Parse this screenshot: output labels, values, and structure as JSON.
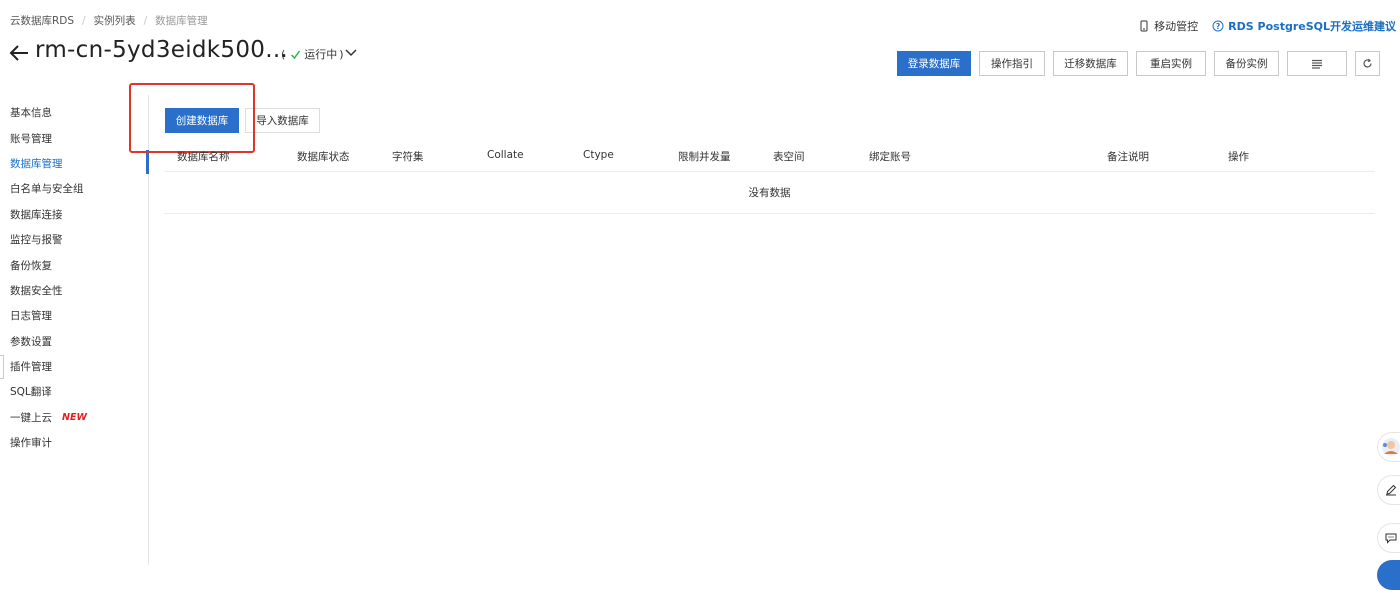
{
  "breadcrumb": {
    "items": [
      "云数据库RDS",
      "实例列表",
      "数据库管理"
    ]
  },
  "top_links": {
    "mobile": "移动管控",
    "advice": "RDS PostgreSQL开发运维建议"
  },
  "instance": {
    "name": "rm-cn-5yd3eidk500...",
    "status": "运行中"
  },
  "actions": {
    "login": "登录数据库",
    "guide": "操作指引",
    "migrate": "迁移数据库",
    "restart": "重启实例",
    "backup": "备份实例"
  },
  "sidebar": {
    "items": [
      {
        "label": "基本信息"
      },
      {
        "label": "账号管理"
      },
      {
        "label": "数据库管理"
      },
      {
        "label": "白名单与安全组"
      },
      {
        "label": "数据库连接"
      },
      {
        "label": "监控与报警"
      },
      {
        "label": "备份恢复"
      },
      {
        "label": "数据安全性"
      },
      {
        "label": "日志管理"
      },
      {
        "label": "参数设置"
      },
      {
        "label": "插件管理"
      },
      {
        "label": "SQL翻译"
      },
      {
        "label": "一键上云",
        "badge": "NEW"
      },
      {
        "label": "操作审计"
      }
    ]
  },
  "content": {
    "create_db": "创建数据库",
    "import_db": "导入数据库"
  },
  "table": {
    "columns": [
      "数据库名称",
      "数据库状态",
      "字符集",
      "Collate",
      "Ctype",
      "限制并发量",
      "表空间",
      "绑定账号",
      "备注说明",
      "操作"
    ],
    "empty_text": "没有数据"
  },
  "colors": {
    "primary": "#2a6fc9",
    "active_text": "#1a6fc4",
    "highlight": "#e0352b",
    "success": "#2db24a",
    "new_badge": "#e02020"
  }
}
